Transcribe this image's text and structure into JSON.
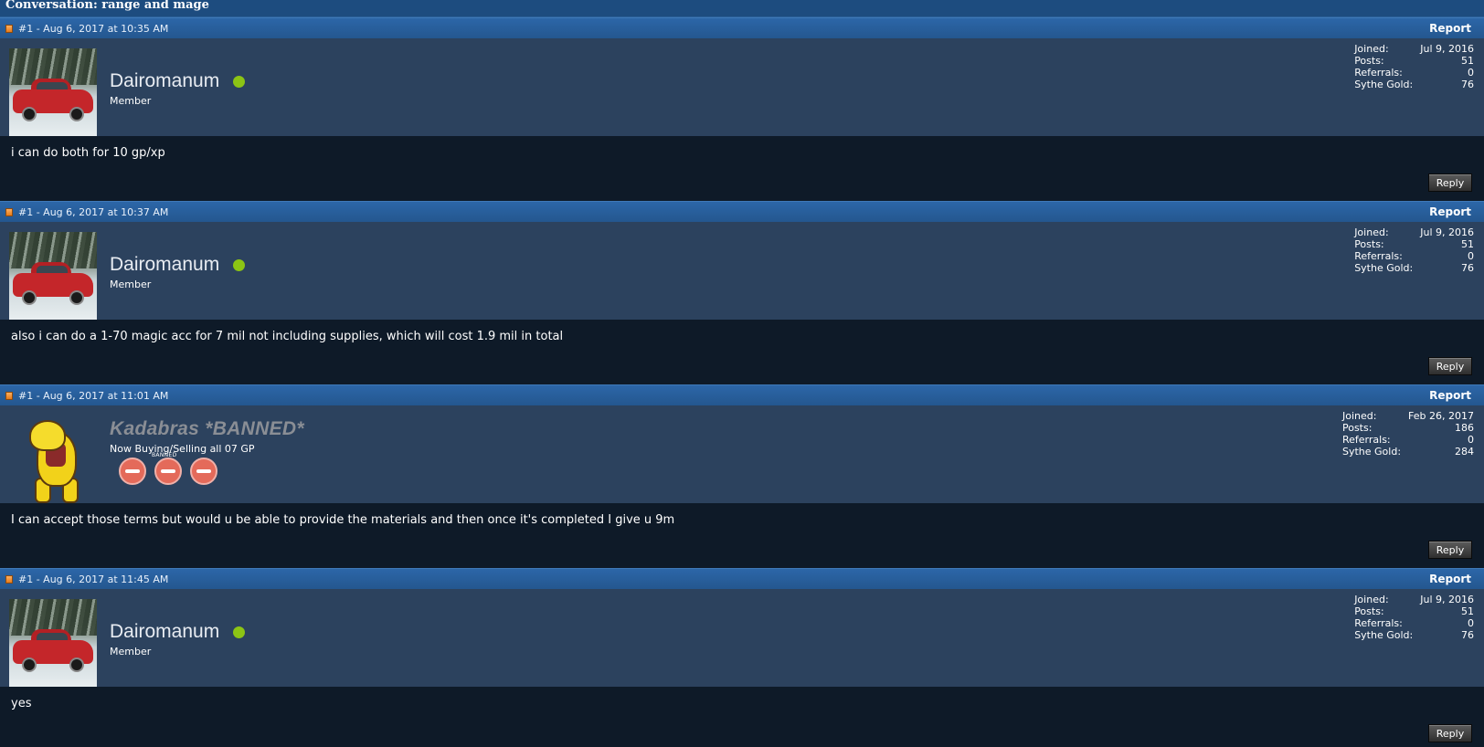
{
  "conversation": {
    "title": "Conversation: range and mage"
  },
  "posts": [
    {
      "meta": "#1 - Aug 6, 2017 at 10:35 AM",
      "report_label": "Report",
      "username": "Dairomanum",
      "user_title": "Member",
      "online": true,
      "stats": {
        "joined_label": "Joined:",
        "joined_value": "Jul 9, 2016",
        "posts_label": "Posts:",
        "posts_value": "51",
        "referrals_label": "Referrals:",
        "referrals_value": "0",
        "gold_label": "Sythe Gold:",
        "gold_value": "76"
      },
      "message": "i can do both for 10 gp/xp",
      "reply_label": "Reply"
    },
    {
      "meta": "#1 - Aug 6, 2017 at 10:37 AM",
      "report_label": "Report",
      "username": "Dairomanum",
      "user_title": "Member",
      "online": true,
      "stats": {
        "joined_label": "Joined:",
        "joined_value": "Jul 9, 2016",
        "posts_label": "Posts:",
        "posts_value": "51",
        "referrals_label": "Referrals:",
        "referrals_value": "0",
        "gold_label": "Sythe Gold:",
        "gold_value": "76"
      },
      "message": "also i can do a 1-70 magic acc for 7 mil not including supplies, which will cost 1.9 mil in total",
      "reply_label": "Reply"
    },
    {
      "meta": "#1 - Aug 6, 2017 at 11:01 AM",
      "report_label": "Report",
      "username": "Kadabras *BANNED*",
      "user_title": "Now Buying/Selling all 07 GP",
      "banned_label": "BANNED",
      "online": false,
      "stats": {
        "joined_label": "Joined:",
        "joined_value": "Feb 26, 2017",
        "posts_label": "Posts:",
        "posts_value": "186",
        "referrals_label": "Referrals:",
        "referrals_value": "0",
        "gold_label": "Sythe Gold:",
        "gold_value": "284"
      },
      "message": "I can accept those terms but would u be able to provide the materials and then once it's completed I give u 9m",
      "reply_label": "Reply"
    },
    {
      "meta": "#1 - Aug 6, 2017 at 11:45 AM",
      "report_label": "Report",
      "username": "Dairomanum",
      "user_title": "Member",
      "online": true,
      "stats": {
        "joined_label": "Joined:",
        "joined_value": "Jul 9, 2016",
        "posts_label": "Posts:",
        "posts_value": "51",
        "referrals_label": "Referrals:",
        "referrals_value": "0",
        "gold_label": "Sythe Gold:",
        "gold_value": "76"
      },
      "message": "yes",
      "reply_label": "Reply"
    }
  ],
  "icons": {
    "post_note": "note-icon",
    "online": "online-status-icon",
    "banned_badge": "no-entry-icon"
  },
  "colors": {
    "header_bar": "#2c66a8",
    "user_panel": "#2c425e",
    "message_bg": "#0e1a28",
    "online": "#8cc414",
    "banned_name": "#8a8e95"
  }
}
